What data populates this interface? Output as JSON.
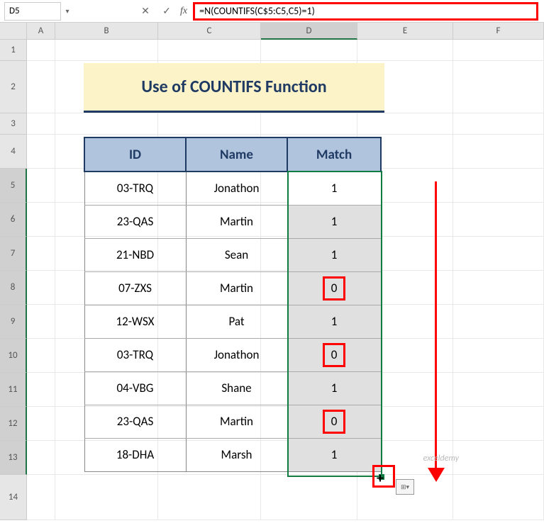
{
  "nameBox": "D5",
  "formula": "=N(COUNTIFS(C$5:C5,C5)=1)",
  "columns": [
    "A",
    "B",
    "C",
    "D",
    "E",
    "F"
  ],
  "rows": [
    "1",
    "2",
    "3",
    "4",
    "5",
    "6",
    "7",
    "8",
    "9",
    "10",
    "11",
    "12",
    "13",
    "14"
  ],
  "title": "Use of COUNTIFS Function",
  "headers": {
    "id": "ID",
    "name": "Name",
    "match": "Match"
  },
  "data": [
    {
      "id": "03-TRQ",
      "name": "Jonathon",
      "match": "1",
      "highlight": false,
      "first": true
    },
    {
      "id": "23-QAS",
      "name": "Martin",
      "match": "1",
      "highlight": false,
      "first": false
    },
    {
      "id": "21-NBD",
      "name": "Sean",
      "match": "1",
      "highlight": false,
      "first": false
    },
    {
      "id": "07-ZXS",
      "name": "Martin",
      "match": "0",
      "highlight": true,
      "first": false
    },
    {
      "id": "12-WSX",
      "name": "Pat",
      "match": "1",
      "highlight": false,
      "first": false
    },
    {
      "id": "03-TRQ",
      "name": "Jonathon",
      "match": "0",
      "highlight": true,
      "first": false
    },
    {
      "id": "04-VBG",
      "name": "Shane",
      "match": "1",
      "highlight": false,
      "first": false
    },
    {
      "id": "23-QAS",
      "name": "Martin",
      "match": "0",
      "highlight": true,
      "first": false
    },
    {
      "id": "18-DHA",
      "name": "Marsh",
      "match": "1",
      "highlight": false,
      "first": false
    }
  ],
  "watermark": "exceldemy"
}
